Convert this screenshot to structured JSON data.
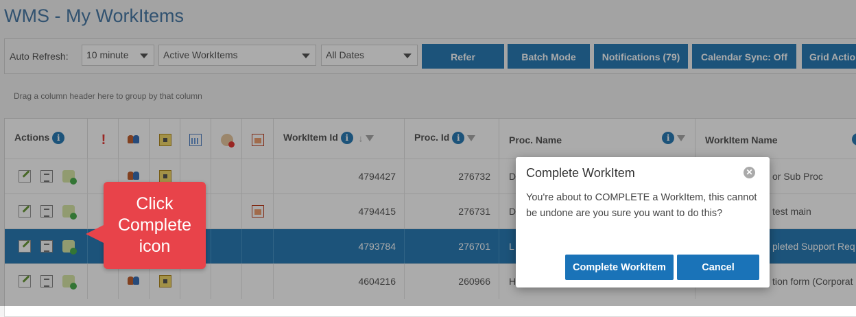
{
  "page": {
    "title": "WMS - My WorkItems"
  },
  "toolbar": {
    "auto_refresh_label": "Auto Refresh:",
    "auto_refresh_value": "10 minute",
    "filter_value": "Active WorkItems",
    "dates_value": "All Dates",
    "refer_label": "Refer",
    "batch_label": "Batch Mode",
    "notifications_label": "Notifications (79)",
    "calendar_label": "Calendar Sync: Off",
    "grid_label": "Grid Actions"
  },
  "grid": {
    "group_hint": "Drag a column header here to group by that column",
    "headers": {
      "actions": "Actions",
      "workitem_id": "WorkItem Id",
      "proc_id": "Proc. Id",
      "proc_name": "Proc. Name",
      "workitem_name": "WorkItem Name"
    },
    "rows": [
      {
        "workitem_id": "4794427",
        "proc_id": "276732",
        "proc_name": "D",
        "workitem_name": "or Sub Proc"
      },
      {
        "workitem_id": "4794415",
        "proc_id": "276731",
        "proc_name": "D",
        "workitem_name": "test main"
      },
      {
        "workitem_id": "4793784",
        "proc_id": "276701",
        "proc_name": "L",
        "workitem_name": "pleted Support Req"
      },
      {
        "workitem_id": "4604216",
        "proc_id": "260966",
        "proc_name": "H",
        "workitem_name": "tion form (Corporat"
      }
    ]
  },
  "callout": {
    "line1": "Click",
    "line2": "Complete",
    "line3": "icon"
  },
  "dialog": {
    "title": "Complete WorkItem",
    "message": "You're about to COMPLETE a WorkItem, this cannot be undone are you sure you want to do this?",
    "confirm_label": "Complete WorkItem",
    "cancel_label": "Cancel"
  },
  "colors": {
    "accent": "#2a7db7",
    "callout": "#e8434a",
    "title": "#4a7ba7"
  }
}
